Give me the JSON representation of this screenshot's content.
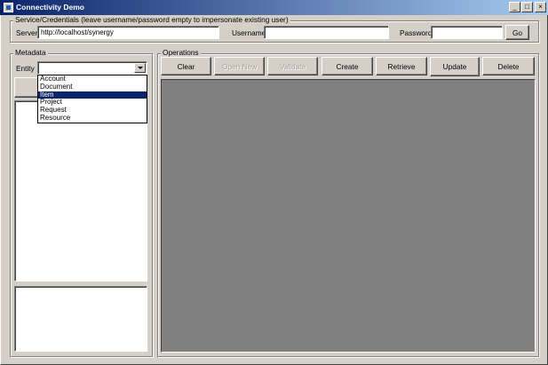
{
  "window": {
    "title": "Connectivity Demo",
    "minimize_glyph": "_",
    "maximize_glyph": "□",
    "close_glyph": "×"
  },
  "service": {
    "group_title": "Service/Credentials (leave username/password empty to impersonate existing user)",
    "server_label": "Server",
    "server_value": "http://localhost/synergy",
    "username_label": "Username",
    "username_value": "",
    "password_label": "Password",
    "password_value": "",
    "go_label": "Go"
  },
  "metadata": {
    "group_title": "Metadata",
    "entity_label": "Entity",
    "entity_value": "",
    "entity_options": [
      "Account",
      "Document",
      "Item",
      "Project",
      "Request",
      "Resource"
    ],
    "selected_option": "Item"
  },
  "operations": {
    "group_title": "Operations",
    "buttons": [
      {
        "label": "Clear",
        "enabled": true
      },
      {
        "label": "Open New",
        "enabled": false
      },
      {
        "label": "Validate",
        "enabled": false
      },
      {
        "label": "Create",
        "enabled": true
      },
      {
        "label": "Retrieve",
        "enabled": true
      },
      {
        "label": "Update",
        "enabled": true
      },
      {
        "label": "Delete",
        "enabled": true
      }
    ]
  },
  "colors": {
    "title_gradient_start": "#0a246a",
    "title_gradient_end": "#a6caf0",
    "face": "#d4d0c8",
    "selection": "#0a246a",
    "canvas": "#808080"
  },
  "icons": {
    "app": "app-window-icon",
    "combo": "chevron-down-icon"
  }
}
